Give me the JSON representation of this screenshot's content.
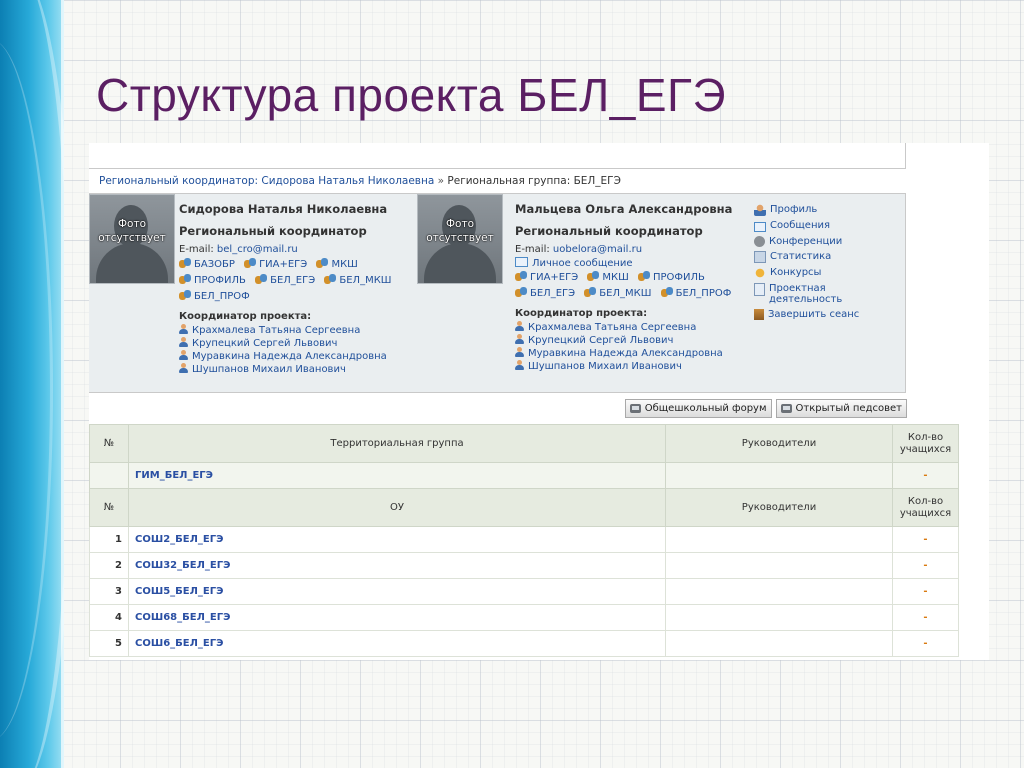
{
  "slide": {
    "title": "Структура проекта БЕЛ_ЕГЭ"
  },
  "breadcrumb": {
    "part1": "Региональный координатор: Сидорова Наталья Николаевна",
    "sep": "»",
    "part2": "Региональная группа: БЕЛ_ЕГЭ"
  },
  "photo_placeholder": "Фото отсутствует",
  "person1": {
    "name": "Сидорова Наталья Николаевна",
    "role": "Региональный координатор",
    "email_label": "E-mail:",
    "email": "bel_cro@mail.ru",
    "tags": [
      "БАЗОБР",
      "ГИА+ЕГЭ",
      "МКШ",
      "ПРОФИЛЬ",
      "БЕЛ_ЕГЭ",
      "БЕЛ_МКШ",
      "БЕЛ_ПРОФ"
    ],
    "coord_label": "Координатор проекта:",
    "coordinators": [
      "Крахмалева Татьяна Сергеевна",
      "Крупецкий Сергей Львович",
      "Муравкина Надежда Александровна",
      "Шушпанов Михаил Иванович"
    ]
  },
  "person2": {
    "name": "Мальцева Ольга Александровна",
    "role": "Региональный координатор",
    "email_label": "E-mail:",
    "email": "uobelora@mail.ru",
    "private_msg": "Личное сообщение",
    "tags": [
      "ГИА+ЕГЭ",
      "МКШ",
      "ПРОФИЛЬ",
      "БЕЛ_ЕГЭ",
      "БЕЛ_МКШ",
      "БЕЛ_ПРОФ"
    ],
    "coord_label": "Координатор проекта:",
    "coordinators": [
      "Крахмалева Татьяна Сергеевна",
      "Крупецкий Сергей Львович",
      "Муравкина Надежда Александровна",
      "Шушпанов Михаил Иванович"
    ]
  },
  "menu": {
    "profile": "Профиль",
    "messages": "Сообщения",
    "conferences": "Конференции",
    "statistics": "Статистика",
    "contests": "Конкурсы",
    "project_activity": "Проектная деятельность",
    "logout": "Завершить сеанс"
  },
  "buttons": {
    "school_forum": "Общешкольный форум",
    "open_council": "Открытый педсовет"
  },
  "table": {
    "header1": {
      "num": "№",
      "group": "Территориальная группа",
      "leaders": "Руководители",
      "count": "Кол-во учащихся"
    },
    "territorial_group": {
      "name": "ГИМ_БЕЛ_ЕГЭ",
      "count": "-"
    },
    "header2": {
      "num": "№",
      "ou": "ОУ",
      "leaders": "Руководители",
      "count": "Кол-во учащихся"
    },
    "rows": [
      {
        "num": "1",
        "name": "СОШ2_БЕЛ_ЕГЭ",
        "count": "-"
      },
      {
        "num": "2",
        "name": "СОШ32_БЕЛ_ЕГЭ",
        "count": "-"
      },
      {
        "num": "3",
        "name": "СОШ5_БЕЛ_ЕГЭ",
        "count": "-"
      },
      {
        "num": "4",
        "name": "СОШ68_БЕЛ_ЕГЭ",
        "count": "-"
      },
      {
        "num": "5",
        "name": "СОШ6_БЕЛ_ЕГЭ",
        "count": "-"
      }
    ]
  },
  "colors": {
    "title": "#5b1f63",
    "link": "#1f4f9a",
    "dash": "#d97a10",
    "strip": "#27a9d8"
  }
}
